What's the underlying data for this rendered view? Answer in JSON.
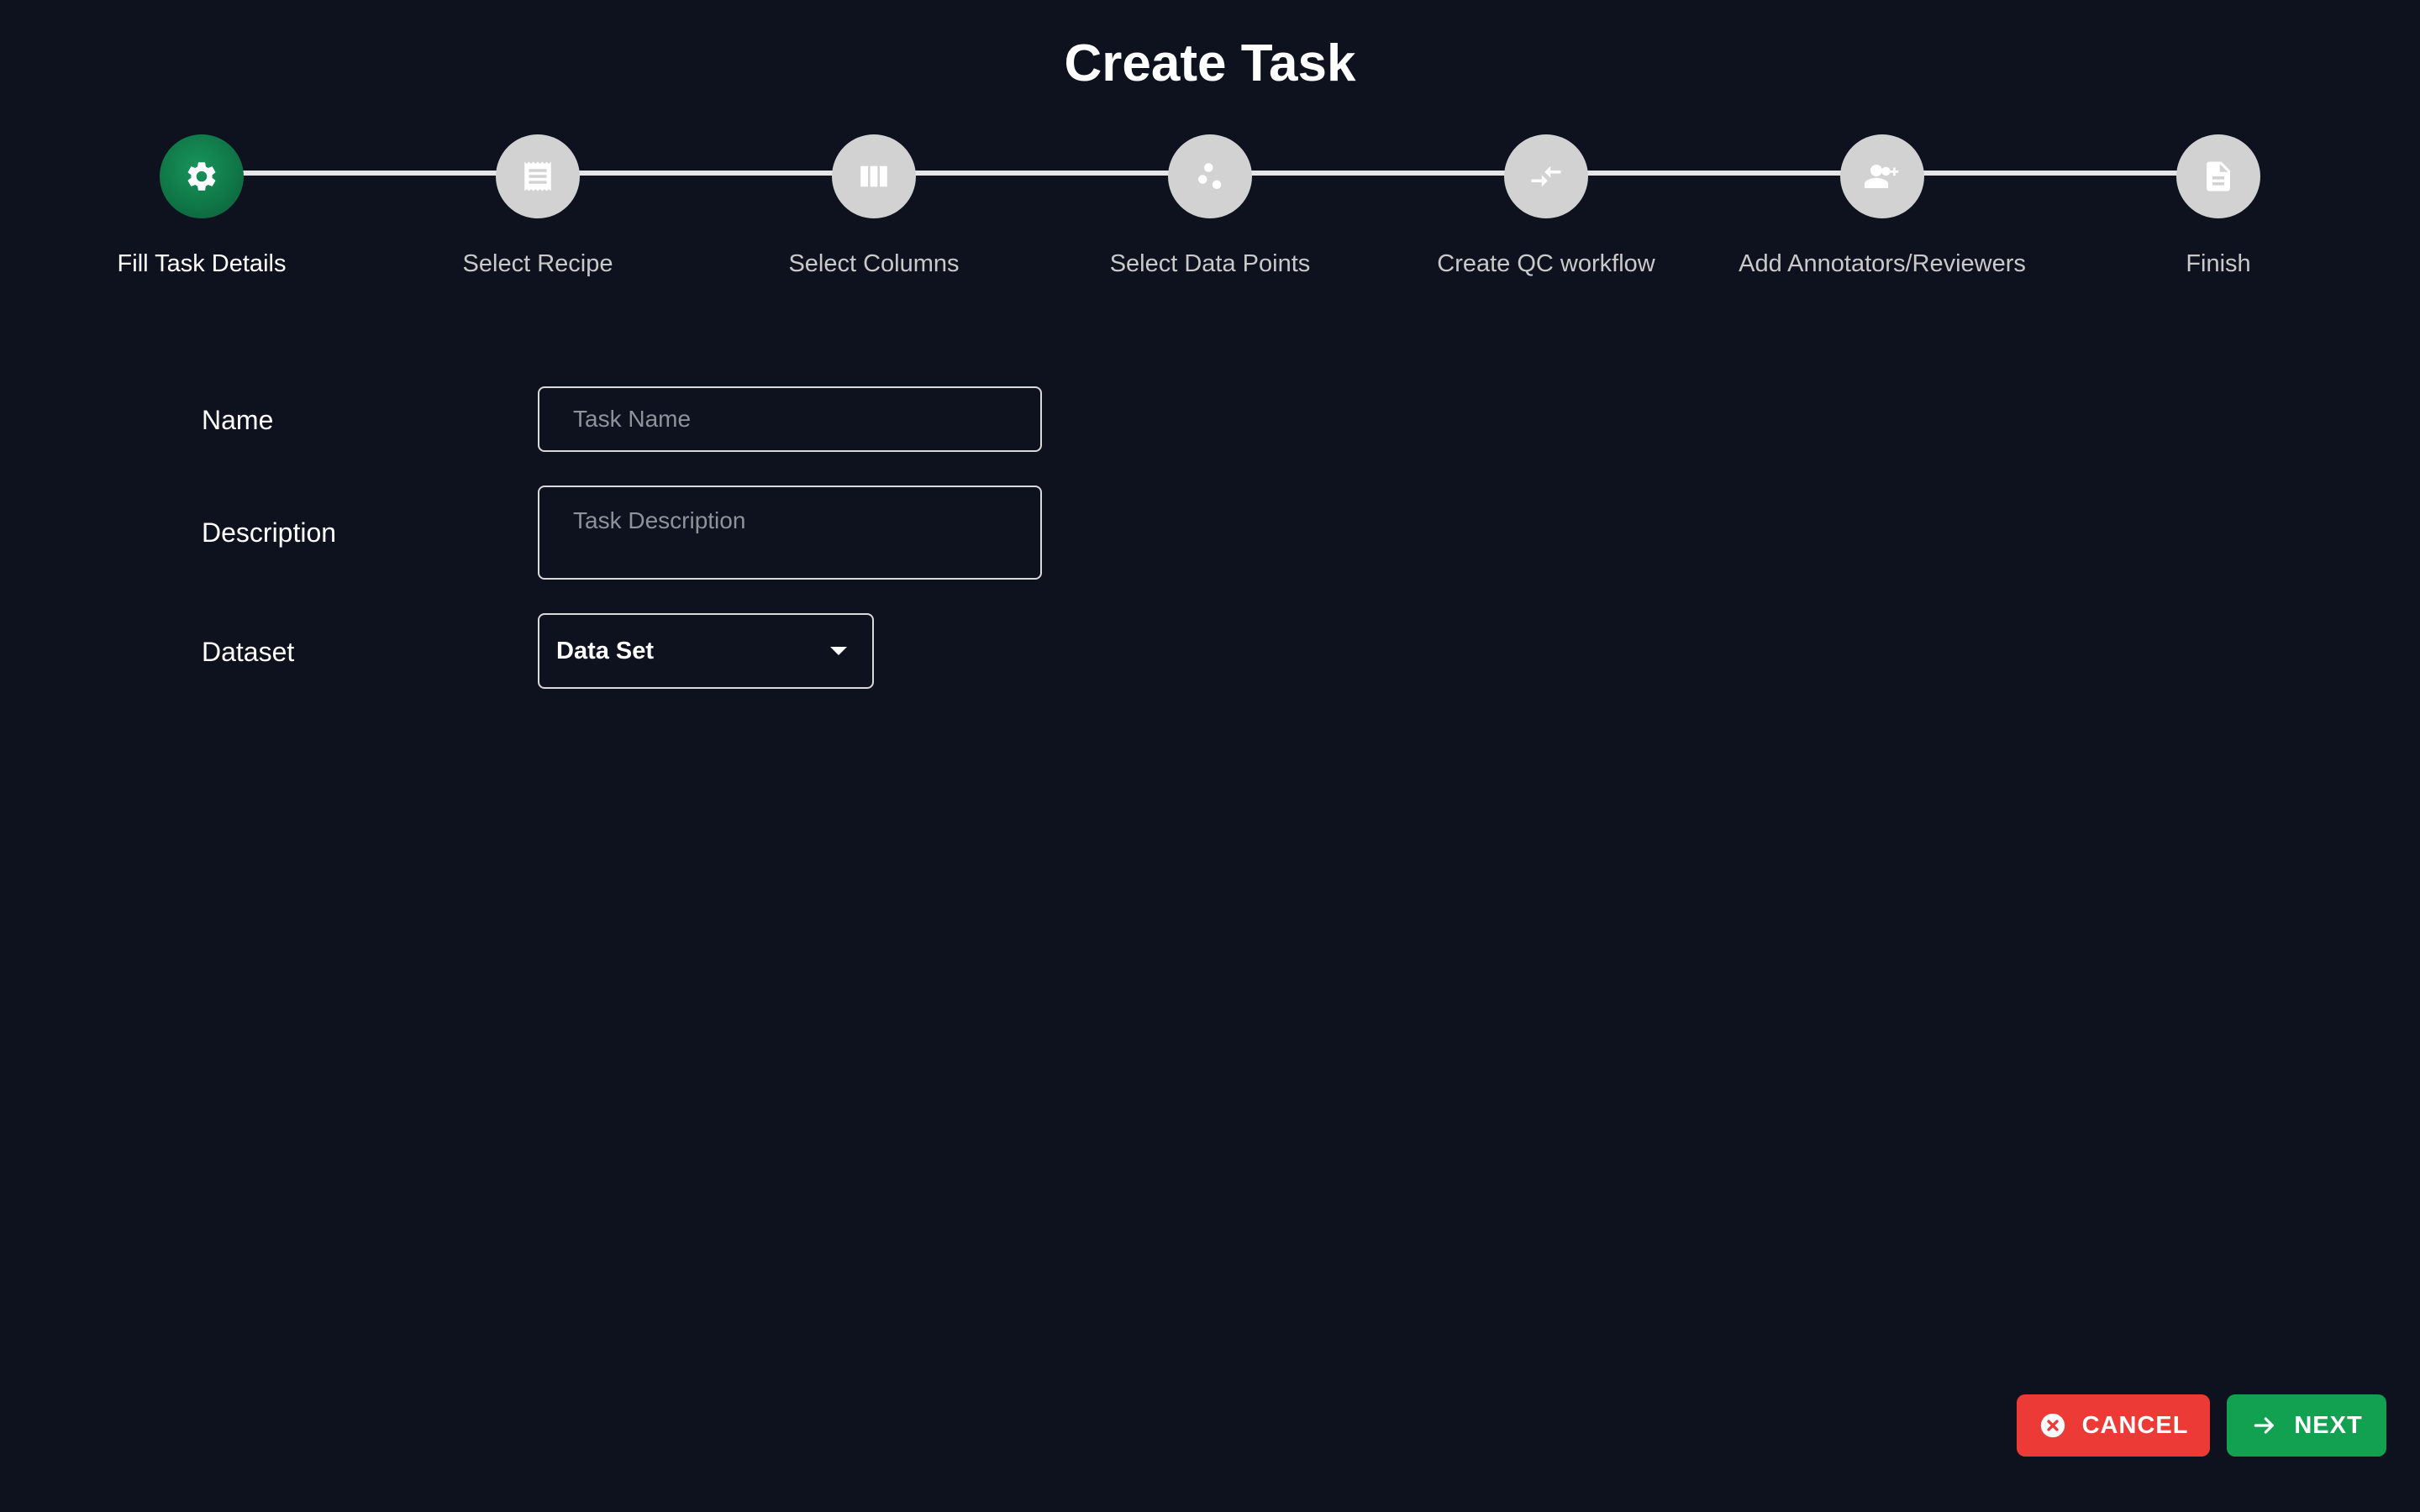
{
  "page": {
    "title": "Create Task"
  },
  "steps": [
    {
      "label": "Fill Task Details",
      "icon": "gear-icon",
      "active": true
    },
    {
      "label": "Select Recipe",
      "icon": "recipe-icon",
      "active": false
    },
    {
      "label": "Select Columns",
      "icon": "columns-icon",
      "active": false
    },
    {
      "label": "Select Data Points",
      "icon": "scatter-icon",
      "active": false
    },
    {
      "label": "Create QC workflow",
      "icon": "compare-arrows-icon",
      "active": false
    },
    {
      "label": "Add Annotators/Reviewers",
      "icon": "add-users-icon",
      "active": false
    },
    {
      "label": "Finish",
      "icon": "document-icon",
      "active": false
    }
  ],
  "form": {
    "name": {
      "label": "Name",
      "placeholder": "Task Name",
      "value": ""
    },
    "description": {
      "label": "Description",
      "placeholder": "Task Description",
      "value": ""
    },
    "dataset": {
      "label": "Dataset",
      "selected": "Data Set"
    }
  },
  "actions": {
    "cancel_label": "CANCEL",
    "next_label": "NEXT"
  },
  "colors": {
    "background": "#0d121e",
    "active_step": "#0f7446",
    "inactive_step": "#d2d2d2",
    "cancel": "#ec3a36",
    "next": "#12a150"
  }
}
